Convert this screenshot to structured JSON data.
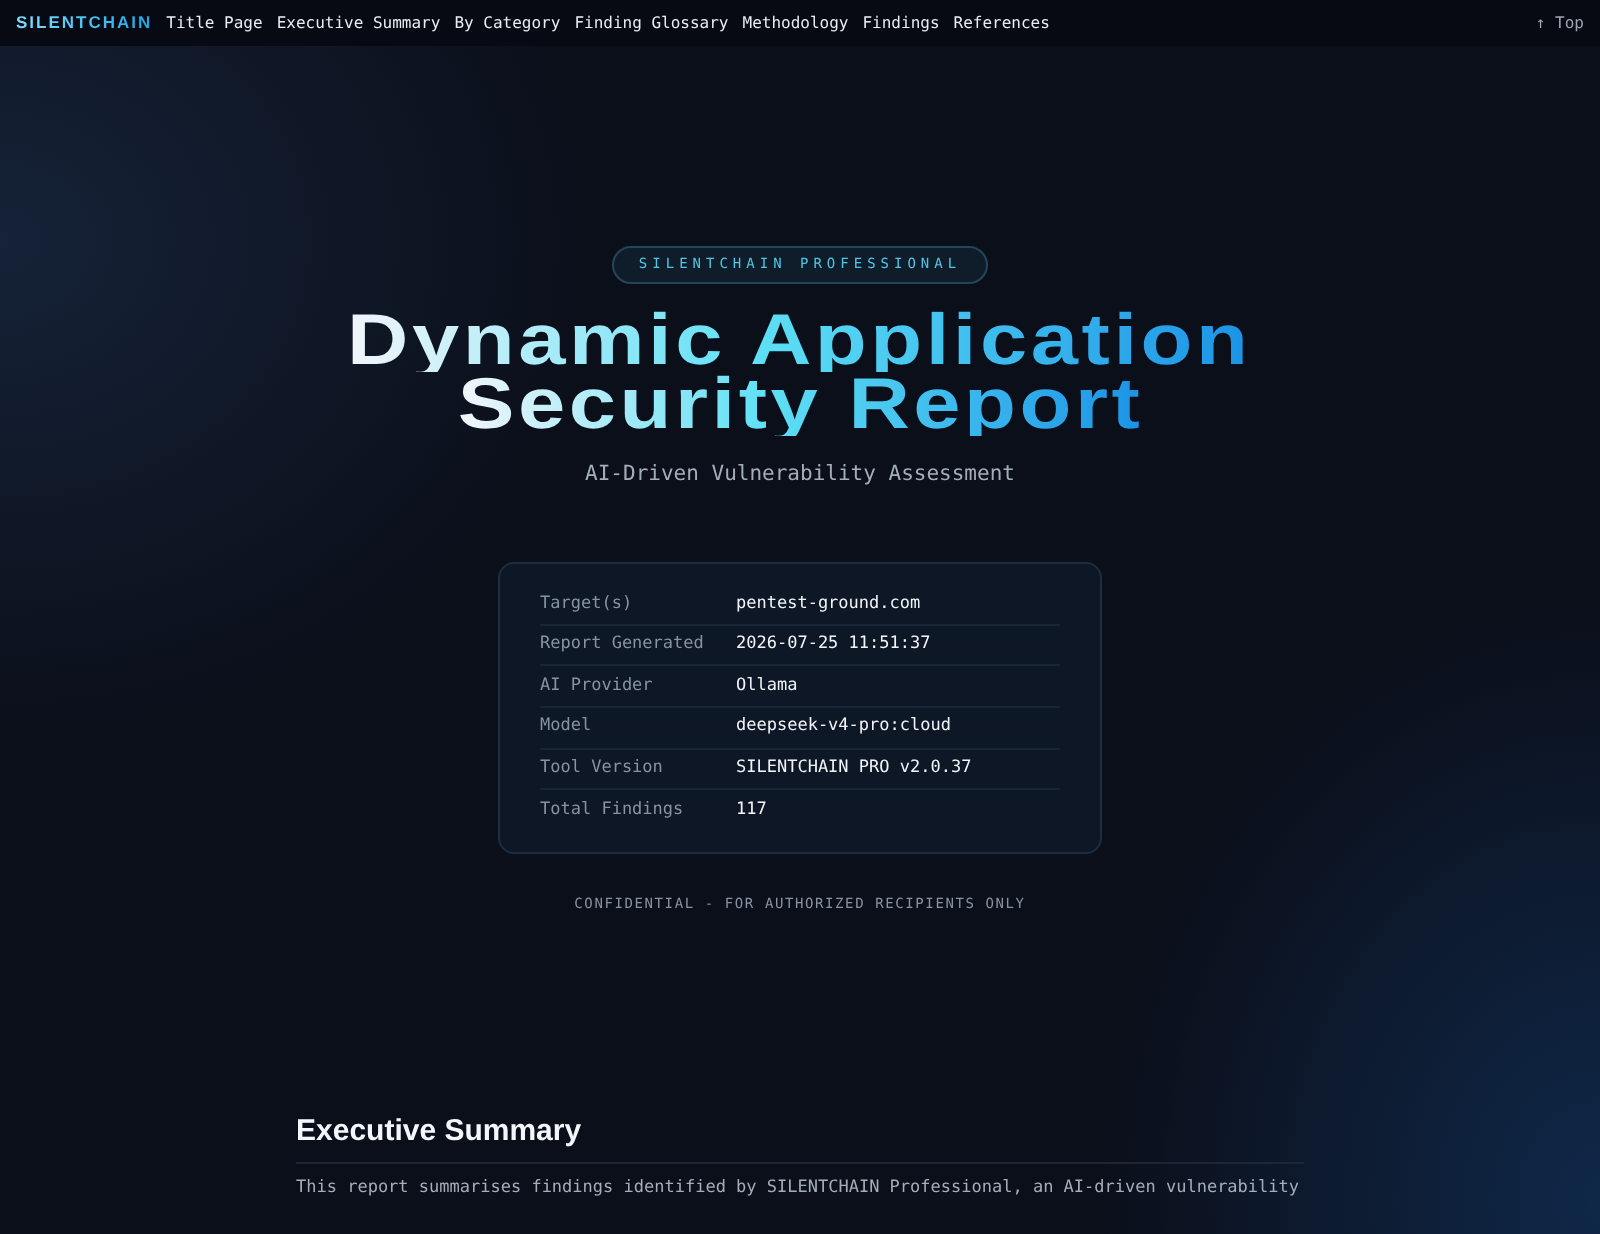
{
  "navbar": {
    "brand": "SILENTCHAIN",
    "links": [
      {
        "label": "Title Page"
      },
      {
        "label": "Executive Summary"
      },
      {
        "label": "By Category"
      },
      {
        "label": "Finding Glossary"
      },
      {
        "label": "Methodology"
      },
      {
        "label": "Findings"
      },
      {
        "label": "References"
      }
    ],
    "top_link": "↑ Top"
  },
  "hero": {
    "badge": "SILENTCHAIN PROFESSIONAL",
    "title_lines": [
      "Dynamic Application",
      "Security Report"
    ],
    "subtitle": "AI-Driven Vulnerability Assessment"
  },
  "details": [
    {
      "label": "Target(s)",
      "value": "pentest-ground.com"
    },
    {
      "label": "Report Generated",
      "value": "2026-07-25 11:51:37"
    },
    {
      "label": "AI Provider",
      "value": "Ollama"
    },
    {
      "label": "Model",
      "value": "deepseek-v4-pro:cloud"
    },
    {
      "label": "Tool Version",
      "value": "SILENTCHAIN PRO v2.0.37"
    },
    {
      "label": "Total Findings",
      "value": "117"
    }
  ],
  "confidential": "CONFIDENTIAL - FOR AUTHORIZED RECIPIENTS ONLY",
  "executive_summary": {
    "heading": "Executive Summary",
    "paragraph": "This report summarises findings identified by SILENTCHAIN Professional, an AI-driven vulnerability"
  }
}
